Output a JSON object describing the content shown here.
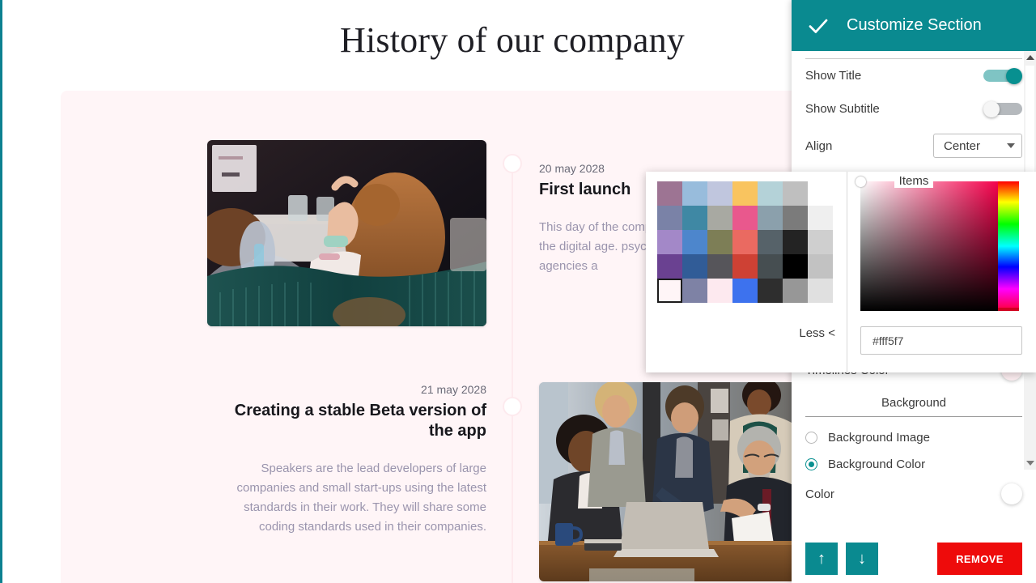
{
  "page": {
    "title": "History of our company",
    "timeline": [
      {
        "date": "20 may 2028",
        "heading": "First launch",
        "body": "This day of the company changes in society in the digital age. psychologists, soc digital agencies a"
      },
      {
        "date": "21 may 2028",
        "heading": "Creating a stable Beta version of the app",
        "body": "Speakers are the lead developers of large companies and small start-ups using the latest standards in their work. They will share some coding standards used in their companies."
      }
    ],
    "section_bg_color": "#fff5f7",
    "timeline_line_color": "#fdeaee",
    "left_edge_color": "#0d8190"
  },
  "panel": {
    "header": {
      "title": "Customize Section",
      "confirm_icon": "check-icon",
      "bg_color": "#0a8a90"
    },
    "controls": {
      "show_title": {
        "label": "Show Title",
        "state": "on"
      },
      "show_subtitle": {
        "label": "Show Subtitle",
        "state": "off"
      },
      "align": {
        "label": "Align",
        "value": "Center",
        "caret_icon": "chevron-down-icon"
      },
      "items_caption": "Items",
      "timelines_color": {
        "label": "Timelines Color",
        "value": "#fdeef1"
      },
      "background_caption": "Background",
      "background_image": {
        "label": "Background  Image",
        "selected": false
      },
      "background_color": {
        "label": "Background Color",
        "selected": true
      },
      "color": {
        "label": "Color",
        "value": "#ffffff"
      }
    },
    "footer": {
      "move_up": "↑",
      "move_down": "↓",
      "remove": "REMOVE",
      "remove_color": "#ee0b0b"
    },
    "scrollbar": {
      "up_arrow": "▲",
      "down_arrow": "▼"
    }
  },
  "color_picker": {
    "less_label": "Less <",
    "hex_value": "#fff5f7",
    "selected_swatch": "#fff5f7",
    "swatches": [
      [
        "#9d7493",
        "#98bcdc",
        "#c0c6de",
        "#f9c45f",
        "#b4d2d8",
        "#bfbfbf",
        "#ffffff"
      ],
      [
        "#7a82a7",
        "#3f88a4",
        "#a8a9a2",
        "#e9588d",
        "#8ba0ac",
        "#7b7b7b",
        "#efefef"
      ],
      [
        "#a388c8",
        "#4d86cc",
        "#7d7e56",
        "#ea6a61",
        "#566269",
        "#232323",
        "#cfcfcf"
      ],
      [
        "#6a4191",
        "#315c97",
        "#56555a",
        "#ce4134",
        "#464e51",
        "#000000",
        "#c2c2c2"
      ],
      [
        "#fff5f7",
        "#7e82a5",
        "#fde9ef",
        "#3d72ee",
        "#2e2e2e",
        "#979797",
        "#e0e0e0"
      ]
    ]
  }
}
